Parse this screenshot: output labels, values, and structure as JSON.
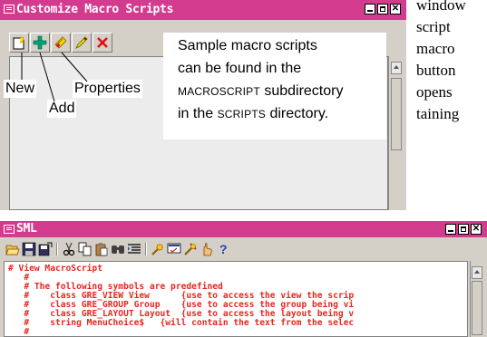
{
  "doc_text": [
    "window",
    "script",
    "macro",
    "button",
    "opens",
    "taining"
  ],
  "customize_window": {
    "title": "Customize Macro Scripts",
    "toolbar_icons": [
      "new-icon",
      "add-icon",
      "properties-icon",
      "edit-icon",
      "delete-icon"
    ],
    "callout": {
      "line1": "Sample macro scripts",
      "line2": "can be found in the",
      "line3_sc": "MACROSCRIPT",
      "line3_rest": " subdirectory",
      "line4_pre": "in the ",
      "line4_sc": "SCRIPTS",
      "line4_post": " directory."
    },
    "labels": {
      "new": "New",
      "add": "Add",
      "properties": "Properties"
    }
  },
  "sml_window": {
    "title": "SML",
    "toolbar_icons": [
      "open-icon",
      "save-icon",
      "save-as-icon",
      "cut-icon",
      "copy-icon",
      "paste-icon",
      "find-icon",
      "indent-icon",
      "run-icon",
      "check-icon",
      "debug-icon",
      "hand-icon",
      "help-icon"
    ],
    "code_lines": [
      "# View MacroScript",
      "   #",
      "   # The following symbols are predefined",
      "   #    class GRE_VIEW View      {use to access the view the scrip",
      "   #    class GRE_GROUP Group    {use to access the group being vi",
      "   #    class GRE_LAYOUT Layout  {use to access the layout being v",
      "   #    string MenuChoice$   {will contain the text from the selec",
      "   #"
    ]
  },
  "colors": {
    "titlebar": "#d33b8f",
    "code_text": "#e8261f",
    "window_bg": "#d4d0c8"
  }
}
